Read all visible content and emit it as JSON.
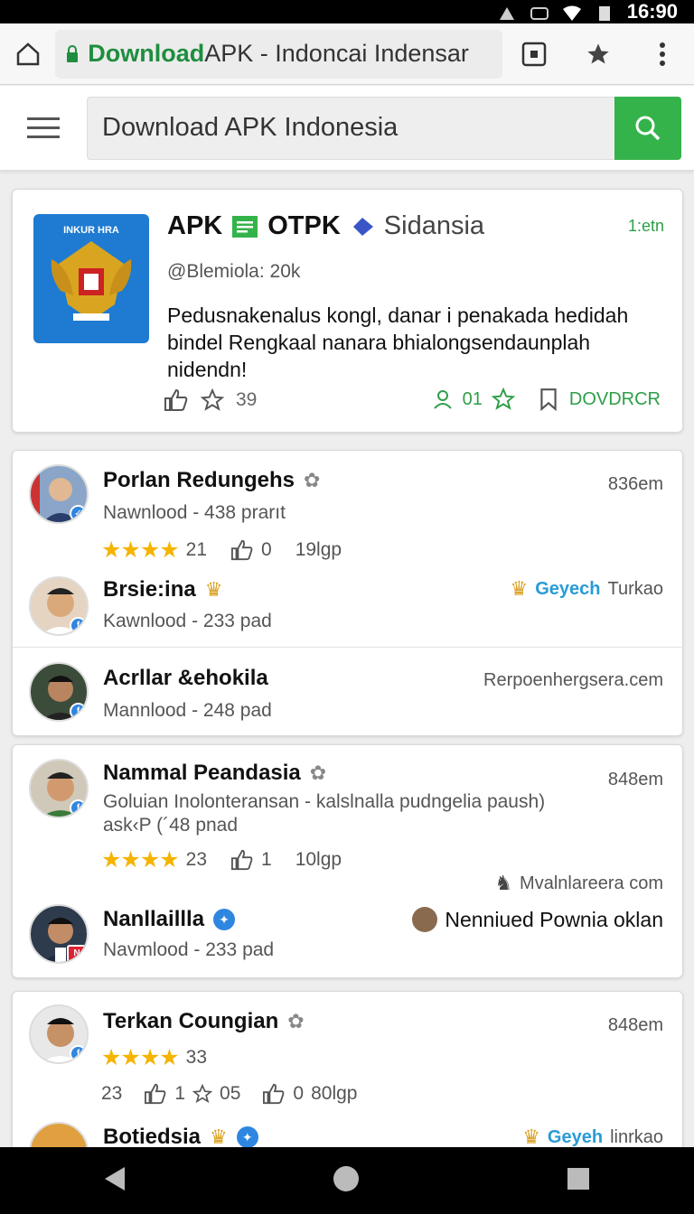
{
  "status_bar": {
    "time": "16:90"
  },
  "browser": {
    "url_host": "Download",
    "url_rest": " APK - Indoncai Indensar"
  },
  "header": {
    "search_value": "Download APK Indonesia"
  },
  "featured": {
    "icon_text": "INKUR HRA",
    "title_a": "APK",
    "title_b": "OTPK",
    "title_c": "Sidansia",
    "time": "1:etn",
    "subtitle": "@Blemiola: 20k",
    "description": "Pedusnakenalus kongl, danar i penakada hedidah bindel Rengkaal nanara bhialongsendaunplah nidendn!",
    "likes": "39",
    "comments": "01",
    "download_label": "DOVDRCR"
  },
  "card1": {
    "r1": {
      "name": "Porlan Redungehs",
      "meta": "Nawnlood - 438 prarıt",
      "time": "836em",
      "rating": "21",
      "thumbs": "0",
      "size": "19lgp"
    },
    "r2": {
      "name": "Brsie:ina",
      "meta": "Kawnlood - 233 pad",
      "tag_a": "Geyech",
      "tag_b": "Turkao"
    },
    "r3": {
      "name": "Acrllar &ehokila",
      "meta": "Mannlood - 248 pad",
      "site": "Rerpoenhergsera.cem"
    }
  },
  "card2": {
    "r1": {
      "name": "Nammal Peandasia",
      "meta": "Goluian Inolonteransan - kalslnalla pudngelia paush) ask‹P (´48 pnad",
      "time": "848em",
      "rating": "23",
      "thumbs": "1",
      "size": "10lgp",
      "site": "Mvalnlareera com"
    },
    "r2": {
      "name": "Nanllaillla",
      "meta": "Navmlood - 233 pad",
      "promo": "Nenniued Pownia oklan"
    }
  },
  "card3": {
    "r1": {
      "name": "Terkan Coungian",
      "time": "848em",
      "rating": "33",
      "count": "23",
      "likes": "1",
      "stars": "05",
      "thumbs": "0",
      "size": "80lgp"
    },
    "r2": {
      "name": "Botiedsia",
      "tag_a": "Geyeh",
      "tag_b": "linrkao"
    }
  },
  "colors": {
    "accent": "#34b34a",
    "link_blue": "#2a9bd6",
    "star": "#f5b400"
  }
}
